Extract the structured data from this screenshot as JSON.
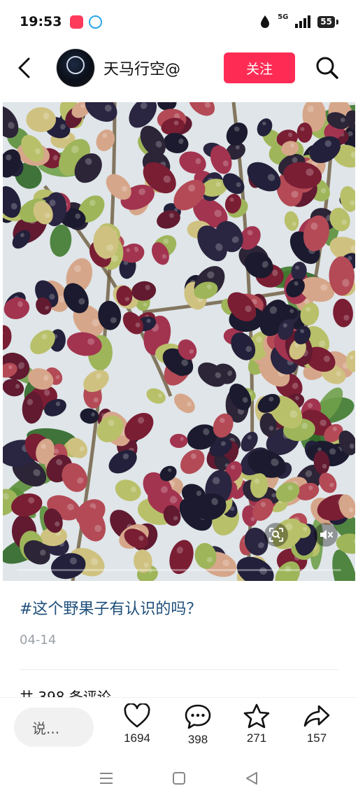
{
  "status_bar": {
    "time": "19:53",
    "network": "5G",
    "battery": "55"
  },
  "header": {
    "username": "天马行空@",
    "follow_label": "关注"
  },
  "post": {
    "caption": "#这个野果子有认识的吗？",
    "date": "04-14",
    "comments_heading": "共 398 条评论"
  },
  "video": {
    "progress": 0.0
  },
  "bottom_bar": {
    "comment_placeholder": "说...",
    "like_count": "1694",
    "comment_count": "398",
    "favorite_count": "271",
    "share_count": "157"
  },
  "colors": {
    "accent": "#fe2c55",
    "link": "#1e4e7a",
    "muted": "#9aa0a6"
  }
}
